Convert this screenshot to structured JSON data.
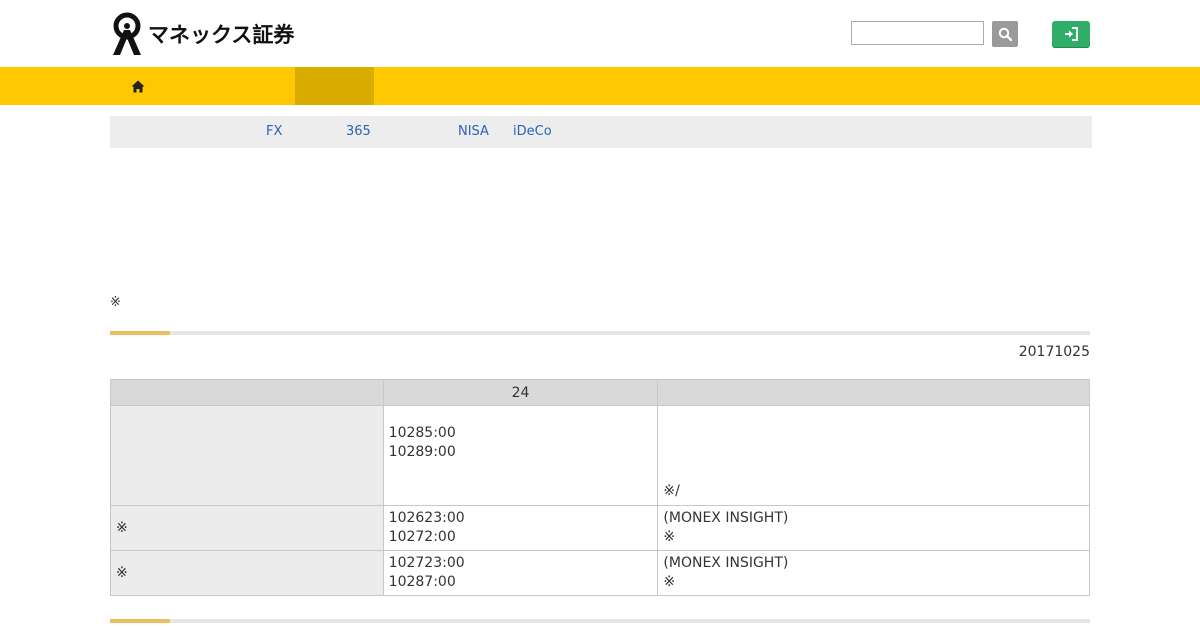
{
  "header": {
    "brand": "マネックス証券",
    "search": {
      "value": "",
      "placeholder": ""
    },
    "icons": {
      "search": "search-icon",
      "login": "login-icon",
      "home": "home-icon"
    }
  },
  "colors": {
    "nav": "#ffc800",
    "nav_active": "#d9ad00",
    "login": "#2fae69",
    "link": "#2a62b8"
  },
  "subnav": {
    "items": [
      "FX",
      "365",
      "NISA",
      "iDeCo"
    ]
  },
  "note": "※",
  "date": "20171025",
  "table": {
    "headers": [
      "",
      "24",
      ""
    ],
    "rows": [
      {
        "label": "",
        "times": [
          "10285:00",
          "10289:00"
        ],
        "info": [
          "※/"
        ]
      },
      {
        "label": "※",
        "times": [
          "102623:00",
          "10272:00"
        ],
        "info": [
          "(MONEX INSIGHT)",
          "※"
        ]
      },
      {
        "label": "※",
        "times": [
          "102723:00",
          "10287:00"
        ],
        "info": [
          "(MONEX INSIGHT)",
          "※"
        ]
      }
    ]
  }
}
